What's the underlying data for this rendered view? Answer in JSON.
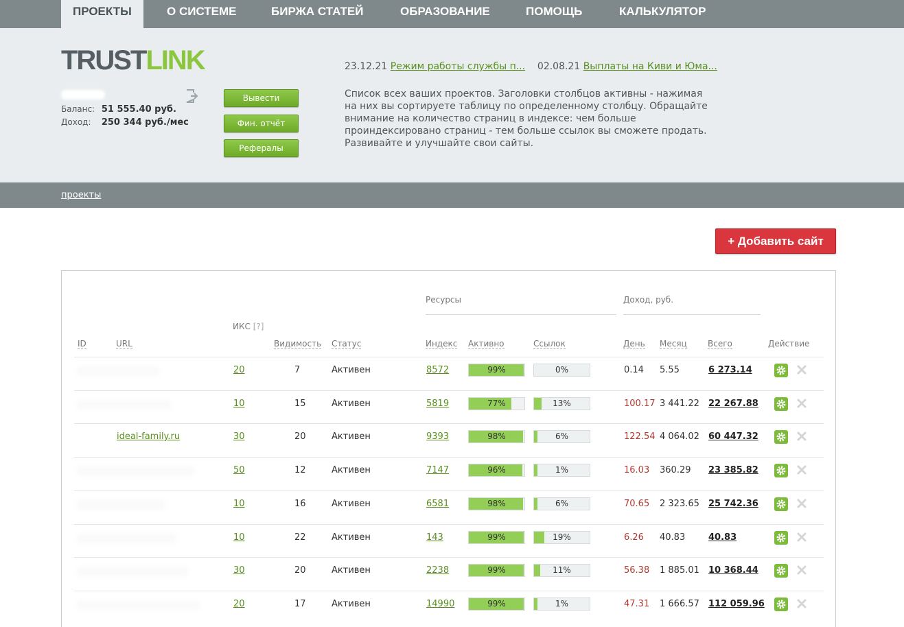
{
  "nav": {
    "tabs": [
      {
        "label": "ПРОЕКТЫ"
      },
      {
        "label": "О СИСТЕМЕ"
      },
      {
        "label": "БИРЖА СТАТЕЙ"
      },
      {
        "label": "ОБРАЗОВАНИЕ"
      },
      {
        "label": "ПОМОЩЬ"
      },
      {
        "label": "КАЛЬКУЛЯТОР"
      }
    ]
  },
  "logo": {
    "part1": "TRUST",
    "part2": "LINK"
  },
  "account": {
    "balance_label": "Баланс:",
    "balance_value": "51 555.40  руб.",
    "income_label": "Доход:",
    "income_value": "250 344 руб./мес"
  },
  "buttons": {
    "withdraw": "Вывести",
    "report": "Фин. отчёт",
    "referrals": "Рефералы",
    "add_site": "+ Добавить сайт"
  },
  "news": [
    {
      "date": "23.12.21",
      "title": "Режим работы службы п..."
    },
    {
      "date": "02.08.21",
      "title": "Выплаты на Киви и Юма..."
    }
  ],
  "description": "Список всех ваших проектов. Заголовки столбцов активны - нажимая на них вы сортируете таблицу по определенному столбцу. Обращайте внимание на количество страниц в индексе: чем больше проиндексировано страниц - тем больше ссылок вы сможете продать. Развивайте и улучшайте свои сайты.",
  "breadcrumb": "проекты",
  "table": {
    "group_resources": "Ресурсы",
    "group_income": "Доход,  руб.",
    "headers": {
      "id": "ID",
      "url": "URL",
      "iks": "ИКС",
      "iks_hint": "[?]",
      "visibility": "Видимость",
      "status": "Статус",
      "index": "Индекс",
      "active": "Активно",
      "links": "Ссылок",
      "day": "День",
      "month": "Месяц",
      "total": "Всего",
      "action": "Действие"
    },
    "rows": [
      {
        "url": "",
        "iks": "20",
        "visibility": "7",
        "status": "Активен",
        "index": "8572",
        "active": "99%",
        "active_pct": 99,
        "links": "0%",
        "links_pct": 0,
        "day": "0.14",
        "day_red": false,
        "month": "5.55",
        "total": "6 273.14"
      },
      {
        "url": "",
        "iks": "10",
        "visibility": "15",
        "status": "Активен",
        "index": "5819",
        "active": "77%",
        "active_pct": 77,
        "links": "13%",
        "links_pct": 13,
        "day": "100.17",
        "day_red": true,
        "month": "3 441.22",
        "total": "22 267.88"
      },
      {
        "url": "ideal-family.ru",
        "iks": "30",
        "visibility": "20",
        "status": "Активен",
        "index": "9393",
        "active": "98%",
        "active_pct": 98,
        "links": "6%",
        "links_pct": 6,
        "day": "122.54",
        "day_red": true,
        "month": "4 064.02",
        "total": "60 447.32"
      },
      {
        "url": "",
        "iks": "50",
        "visibility": "12",
        "status": "Активен",
        "index": "7147",
        "active": "96%",
        "active_pct": 96,
        "links": "1%",
        "links_pct": 1,
        "day": "16.03",
        "day_red": true,
        "month": "360.29",
        "total": "23 385.82"
      },
      {
        "url": "",
        "iks": "10",
        "visibility": "16",
        "status": "Активен",
        "index": "6581",
        "active": "98%",
        "active_pct": 98,
        "links": "6%",
        "links_pct": 6,
        "day": "70.65",
        "day_red": true,
        "month": "2 323.65",
        "total": "25 742.36"
      },
      {
        "url": "",
        "iks": "10",
        "visibility": "22",
        "status": "Активен",
        "index": "143",
        "active": "99%",
        "active_pct": 99,
        "links": "19%",
        "links_pct": 19,
        "day": "6.26",
        "day_red": true,
        "month": "40.83",
        "total": "40.83"
      },
      {
        "url": "",
        "iks": "30",
        "visibility": "20",
        "status": "Активен",
        "index": "2238",
        "active": "99%",
        "active_pct": 99,
        "links": "11%",
        "links_pct": 11,
        "day": "56.38",
        "day_red": true,
        "month": "1 885.01",
        "total": "10 368.44"
      },
      {
        "url": "",
        "iks": "20",
        "visibility": "17",
        "status": "Активен",
        "index": "14990",
        "active": "99%",
        "active_pct": 99,
        "links": "1%",
        "links_pct": 1,
        "day": "47.31",
        "day_red": true,
        "month": "1 666.57",
        "total": "112 059.96"
      }
    ]
  },
  "colors": {
    "accent_green": "#8cc63f",
    "link_green": "#5a8f1f",
    "add_red": "#d9363e",
    "day_red": "#b0392f",
    "nav_gray": "#7f898c"
  }
}
